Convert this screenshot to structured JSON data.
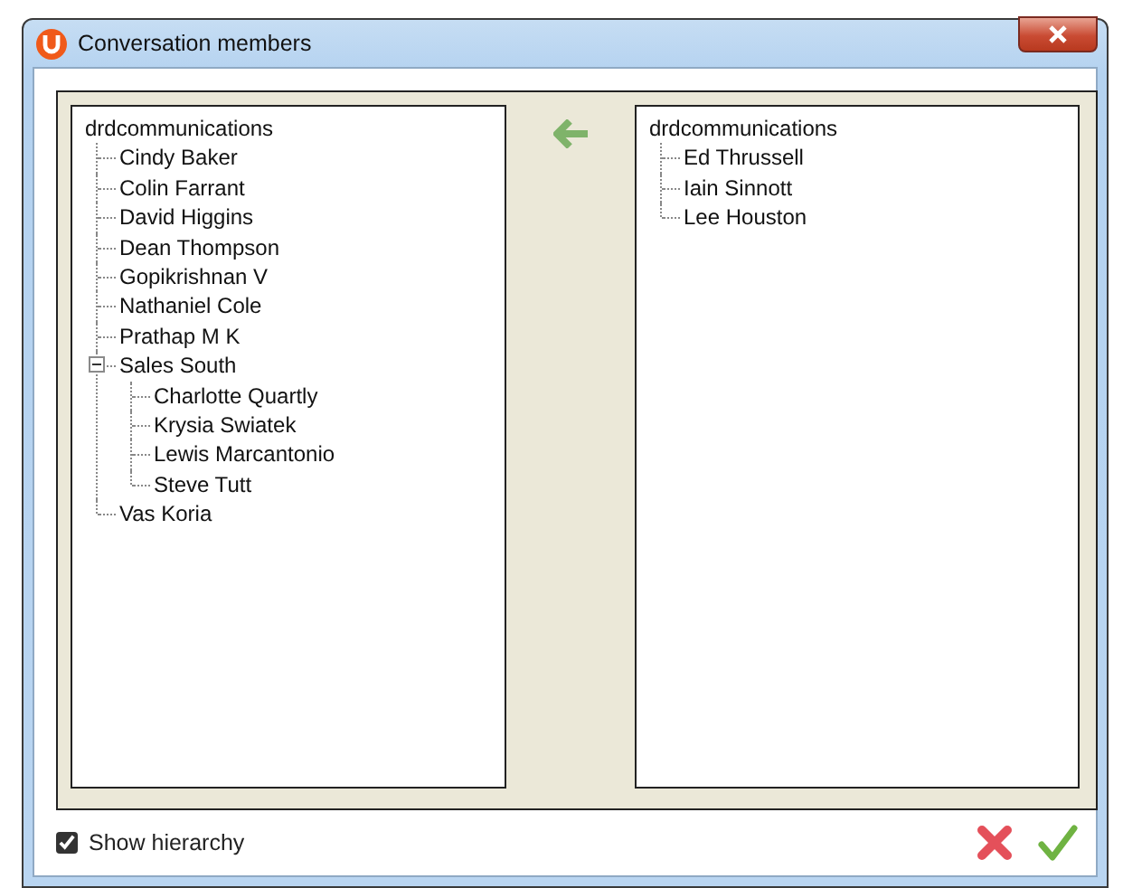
{
  "window": {
    "title": "Conversation members"
  },
  "available_tree": [
    {
      "label": "drdcommunications",
      "children": [
        {
          "label": "Cindy Baker"
        },
        {
          "label": "Colin Farrant"
        },
        {
          "label": "David Higgins"
        },
        {
          "label": "Dean Thompson"
        },
        {
          "label": "Gopikrishnan V"
        },
        {
          "label": "Nathaniel Cole"
        },
        {
          "label": "Prathap M K"
        },
        {
          "label": "Sales South",
          "expanded": true,
          "children": [
            {
              "label": "Charlotte Quartly"
            },
            {
              "label": "Krysia Swiatek"
            },
            {
              "label": "Lewis Marcantonio"
            },
            {
              "label": "Steve Tutt"
            }
          ]
        },
        {
          "label": "Vas Koria"
        }
      ]
    }
  ],
  "members_tree": [
    {
      "label": "drdcommunications",
      "children": [
        {
          "label": "Ed Thrussell"
        },
        {
          "label": "Iain Sinnott"
        },
        {
          "label": "Lee Houston"
        }
      ]
    }
  ],
  "show_hierarchy": {
    "label": "Show hierarchy",
    "checked": true
  }
}
